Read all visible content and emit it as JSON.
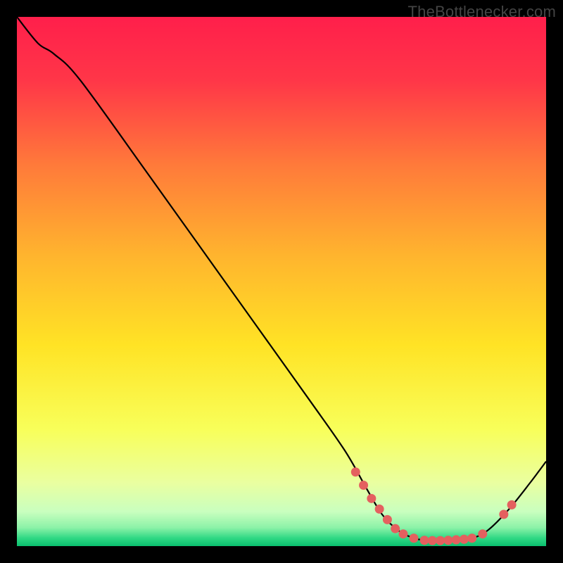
{
  "watermark_text": "TheBottlenecker.com",
  "chart_data": {
    "type": "line",
    "title": "",
    "xlabel": "",
    "ylabel": "",
    "xlim": [
      0,
      100
    ],
    "ylim": [
      0,
      100
    ],
    "curve": [
      {
        "x": 0,
        "y": 100
      },
      {
        "x": 4,
        "y": 95
      },
      {
        "x": 7,
        "y": 93
      },
      {
        "x": 12,
        "y": 88
      },
      {
        "x": 25,
        "y": 70
      },
      {
        "x": 40,
        "y": 49
      },
      {
        "x": 55,
        "y": 28
      },
      {
        "x": 62,
        "y": 18
      },
      {
        "x": 66,
        "y": 11
      },
      {
        "x": 69,
        "y": 6
      },
      {
        "x": 72,
        "y": 3
      },
      {
        "x": 75,
        "y": 1.5
      },
      {
        "x": 78,
        "y": 1
      },
      {
        "x": 82,
        "y": 1
      },
      {
        "x": 86,
        "y": 1.5
      },
      {
        "x": 89,
        "y": 3
      },
      {
        "x": 93,
        "y": 7
      },
      {
        "x": 97,
        "y": 12
      },
      {
        "x": 100,
        "y": 16
      }
    ],
    "markers": [
      {
        "x": 64,
        "y": 14
      },
      {
        "x": 65.5,
        "y": 11.5
      },
      {
        "x": 67,
        "y": 9
      },
      {
        "x": 68.5,
        "y": 7
      },
      {
        "x": 70,
        "y": 5
      },
      {
        "x": 71.5,
        "y": 3.3
      },
      {
        "x": 73,
        "y": 2.3
      },
      {
        "x": 75,
        "y": 1.5
      },
      {
        "x": 77,
        "y": 1.1
      },
      {
        "x": 78.5,
        "y": 1.05
      },
      {
        "x": 80,
        "y": 1.05
      },
      {
        "x": 81.5,
        "y": 1.1
      },
      {
        "x": 83,
        "y": 1.2
      },
      {
        "x": 84.5,
        "y": 1.3
      },
      {
        "x": 86,
        "y": 1.5
      },
      {
        "x": 88,
        "y": 2.3
      },
      {
        "x": 92,
        "y": 6
      },
      {
        "x": 93.5,
        "y": 7.8
      }
    ],
    "gradient_stops": [
      {
        "offset": 0.0,
        "color": "#ff1f4b"
      },
      {
        "offset": 0.12,
        "color": "#ff3648"
      },
      {
        "offset": 0.28,
        "color": "#ff7a3a"
      },
      {
        "offset": 0.45,
        "color": "#ffb42e"
      },
      {
        "offset": 0.62,
        "color": "#ffe325"
      },
      {
        "offset": 0.78,
        "color": "#f8ff5a"
      },
      {
        "offset": 0.88,
        "color": "#eaffa0"
      },
      {
        "offset": 0.935,
        "color": "#c9ffbf"
      },
      {
        "offset": 0.965,
        "color": "#8cf2a8"
      },
      {
        "offset": 0.985,
        "color": "#2fd884"
      },
      {
        "offset": 1.0,
        "color": "#0abf6e"
      }
    ],
    "marker_color": "#e4605f",
    "curve_color": "#000000"
  }
}
